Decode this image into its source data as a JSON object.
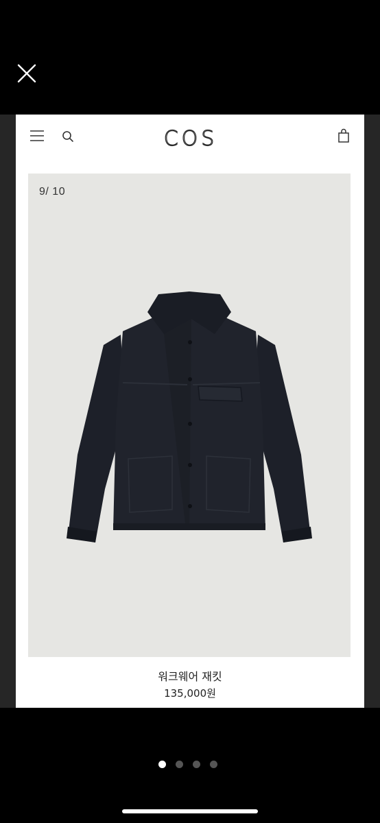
{
  "header": {
    "brand": "COS"
  },
  "gallery": {
    "counter": "9/ 10",
    "image_icon": "jacket-product-photo"
  },
  "product": {
    "name": "워크웨어 재킷",
    "price": "135,000원"
  },
  "pager": {
    "total": 4,
    "active_index": 0
  },
  "colors": {
    "jacket": "#1f222b",
    "photo_bg": "#e6e6e3"
  }
}
